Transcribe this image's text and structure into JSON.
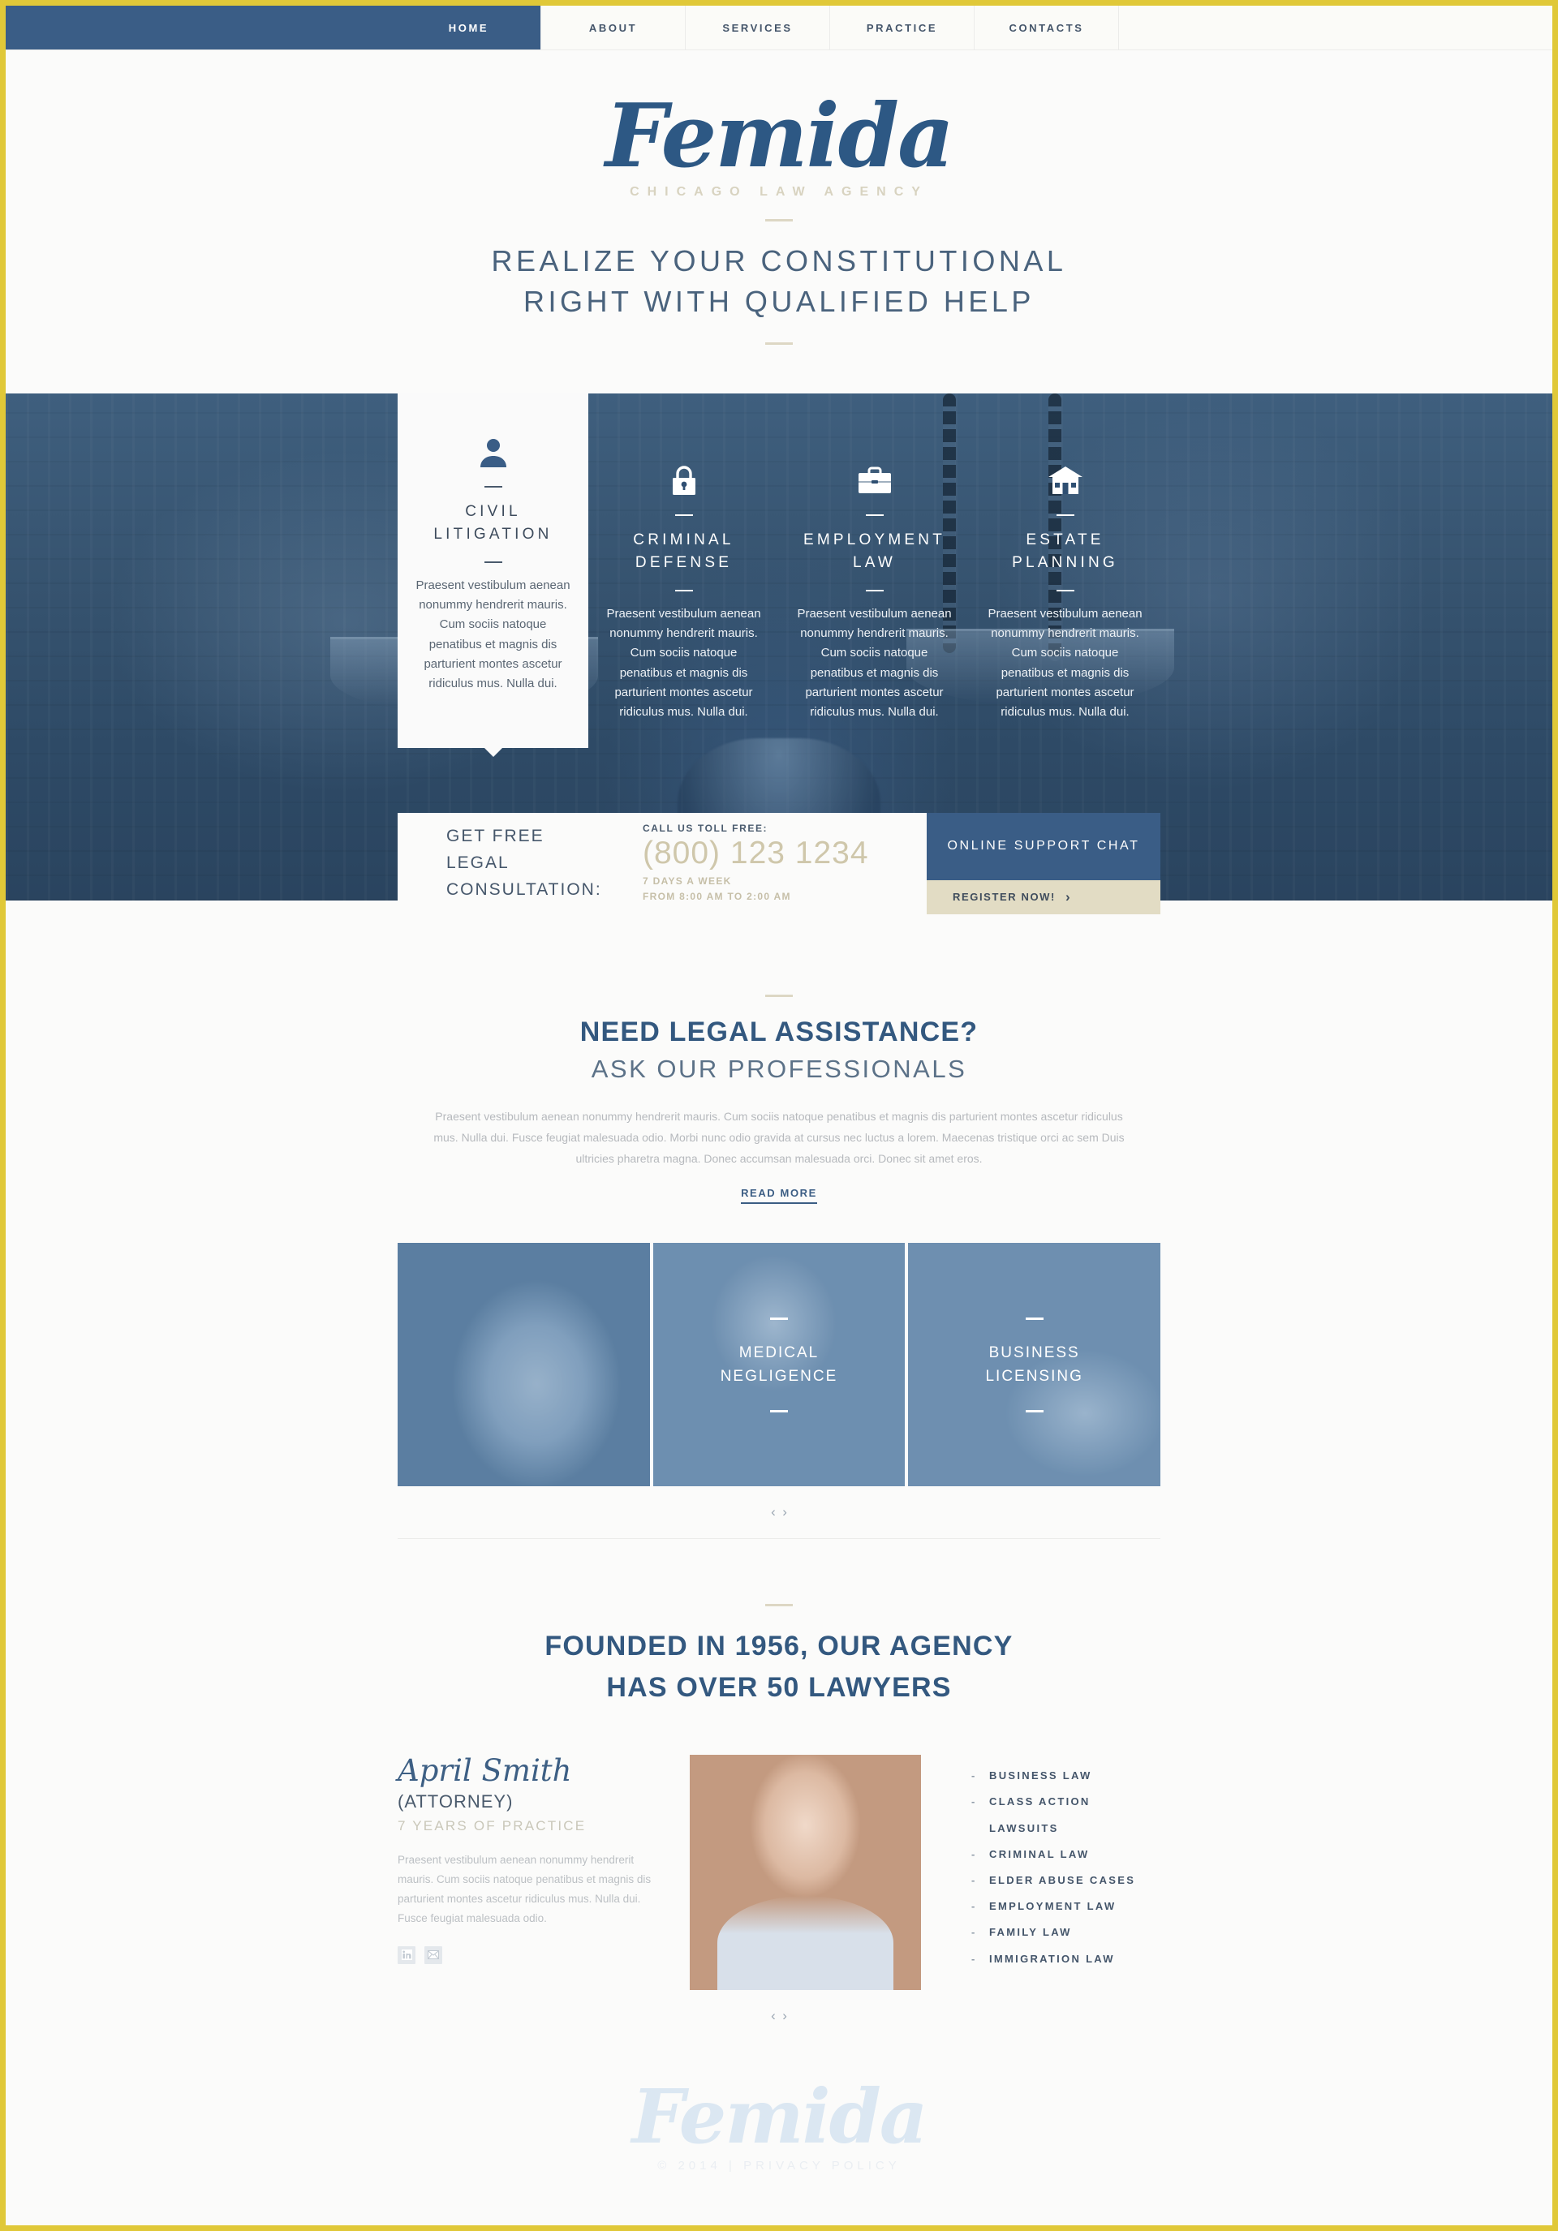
{
  "theme": {
    "border": "#e0c838",
    "primary": "#3a5d86",
    "accent_tan": "#e2dcc4",
    "heading": "#33587f"
  },
  "nav": {
    "items": [
      {
        "label": "HOME",
        "active": true
      },
      {
        "label": "ABOUT",
        "active": false
      },
      {
        "label": "SERVICES",
        "active": false
      },
      {
        "label": "PRACTICE",
        "active": false
      },
      {
        "label": "CONTACTS",
        "active": false
      }
    ]
  },
  "header": {
    "logo": "Femida",
    "logo_sub": "CHICAGO LAW AGENCY",
    "tagline_line1": "REALIZE YOUR CONSTITUTIONAL",
    "tagline_line2": "RIGHT WITH QUALIFIED HELP"
  },
  "hero": {
    "cards": [
      {
        "icon": "person-icon",
        "title_line1": "CIVIL",
        "title_line2": "LITIGATION",
        "text": "Praesent vestibulum aenean nonummy hendrerit mauris. Cum sociis natoque penatibus et magnis dis parturient montes ascetur ridiculus mus. Nulla dui."
      },
      {
        "icon": "lock-icon",
        "title_line1": "CRIMINAL",
        "title_line2": "DEFENSE",
        "text": "Praesent vestibulum aenean nonummy hendrerit mauris. Cum sociis natoque penatibus et magnis dis parturient montes ascetur ridiculus mus. Nulla dui."
      },
      {
        "icon": "briefcase-icon",
        "title_line1": "EMPLOYMENT",
        "title_line2": "LAW",
        "text": "Praesent vestibulum aenean nonummy hendrerit mauris. Cum sociis natoque penatibus et magnis dis parturient montes ascetur ridiculus mus. Nulla dui."
      },
      {
        "icon": "house-icon",
        "title_line1": "ESTATE",
        "title_line2": "PLANNING",
        "text": "Praesent vestibulum aenean nonummy hendrerit mauris. Cum sociis natoque penatibus et magnis dis parturient montes ascetur ridiculus mus. Nulla dui."
      }
    ]
  },
  "cta": {
    "headline_line1": "GET FREE LEGAL",
    "headline_line2": "CONSULTATION:",
    "phone_label": "CALL US TOLL FREE:",
    "phone": "(800) 123 1234",
    "hours_line1": "7 DAYS A WEEK",
    "hours_line2": "FROM 8:00 AM TO 2:00 AM",
    "chat_label": "ONLINE SUPPORT CHAT",
    "register_label": "REGISTER NOW!",
    "register_arrow": "›"
  },
  "assistance": {
    "title": "NEED LEGAL ASSISTANCE?",
    "subtitle": "ASK OUR PROFESSIONALS",
    "body": "Praesent vestibulum aenean nonummy hendrerit mauris. Cum sociis natoque penatibus et magnis dis parturient montes ascetur ridiculus mus. Nulla dui. Fusce feugiat malesuada odio. Morbi nunc odio gravida at cursus nec luctus a lorem. Maecenas tristique orci ac sem Duis ultricies pharetra magna. Donec accumsan malesuada orci. Donec sit amet eros.",
    "read_more": "READ MORE"
  },
  "gallery": {
    "tiles": [
      {
        "title_line1": "",
        "title_line2": "",
        "has_label": false
      },
      {
        "title_line1": "MEDICAL",
        "title_line2": "NEGLIGENCE",
        "has_label": true
      },
      {
        "title_line1": "BUSINESS",
        "title_line2": "LICENSING",
        "has_label": true
      }
    ],
    "prev": "‹",
    "next": "›"
  },
  "founded": {
    "line1": "FOUNDED IN 1956, OUR AGENCY",
    "line2": "HAS OVER 50 LAWYERS"
  },
  "attorney": {
    "name": "April Smith",
    "role": "(ATTORNEY)",
    "years": "7 YEARS OF PRACTICE",
    "bio": "Praesent vestibulum aenean nonummy hendrerit mauris. Cum sociis natoque penatibus et magnis dis parturient montes ascetur ridiculus mus. Nulla dui. Fusce feugiat malesuada odio.",
    "social": [
      "linkedin-icon",
      "email-icon"
    ],
    "practice_areas": [
      "BUSINESS LAW",
      "CLASS ACTION LAWSUITS",
      "CRIMINAL LAW",
      "ELDER ABUSE CASES",
      "EMPLOYMENT LAW",
      "FAMILY LAW",
      "IMMIGRATION LAW"
    ],
    "prev": "‹",
    "next": "›"
  },
  "footer": {
    "logo": "Femida",
    "copyright": "© 2014",
    "separator": "|",
    "privacy": "PRIVACY POLICY"
  }
}
